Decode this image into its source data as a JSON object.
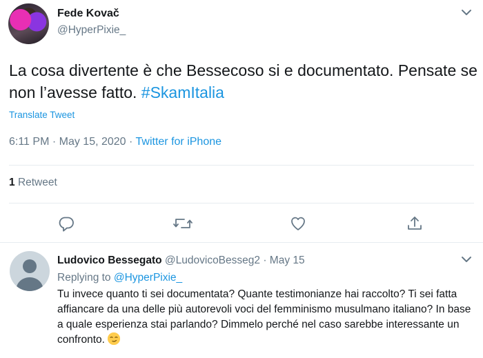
{
  "tweet": {
    "author_name": "Fede Kovač",
    "author_handle": "@HyperPixie_",
    "text": "La cosa divertente è che Bessecoso si e documentato. Pensate se non l’avesse fatto.",
    "hashtag": "#SkamItalia",
    "translate_label": "Translate Tweet",
    "time": "6:11 PM",
    "date": "May 15, 2020",
    "source": "Twitter for iPhone",
    "retweet_count": "1",
    "retweet_label": "Retweet"
  },
  "reply": {
    "author_name": "Ludovico Bessegato",
    "author_handle": "@LudovicoBesseg2",
    "date": "May 15",
    "replying_prefix": "Replying to",
    "replying_to": "@HyperPixie_",
    "text": "Tu invece quanto ti sei documentata? Quante testimonianze hai raccolto? Ti sei fatta affiancare da una delle più autorevoli voci del femminismo musulmano italiano? In base a quale esperienza stai parlando? Dimmelo perché nel caso sarebbe interessante un confronto."
  },
  "colors": {
    "accent": "#1b95e0",
    "secondary_text": "#657786",
    "divider": "#e6ecf0"
  },
  "icons": [
    "caret-down-icon",
    "reply-icon",
    "retweet-icon",
    "like-icon",
    "share-icon",
    "smirking-face-emoji"
  ]
}
